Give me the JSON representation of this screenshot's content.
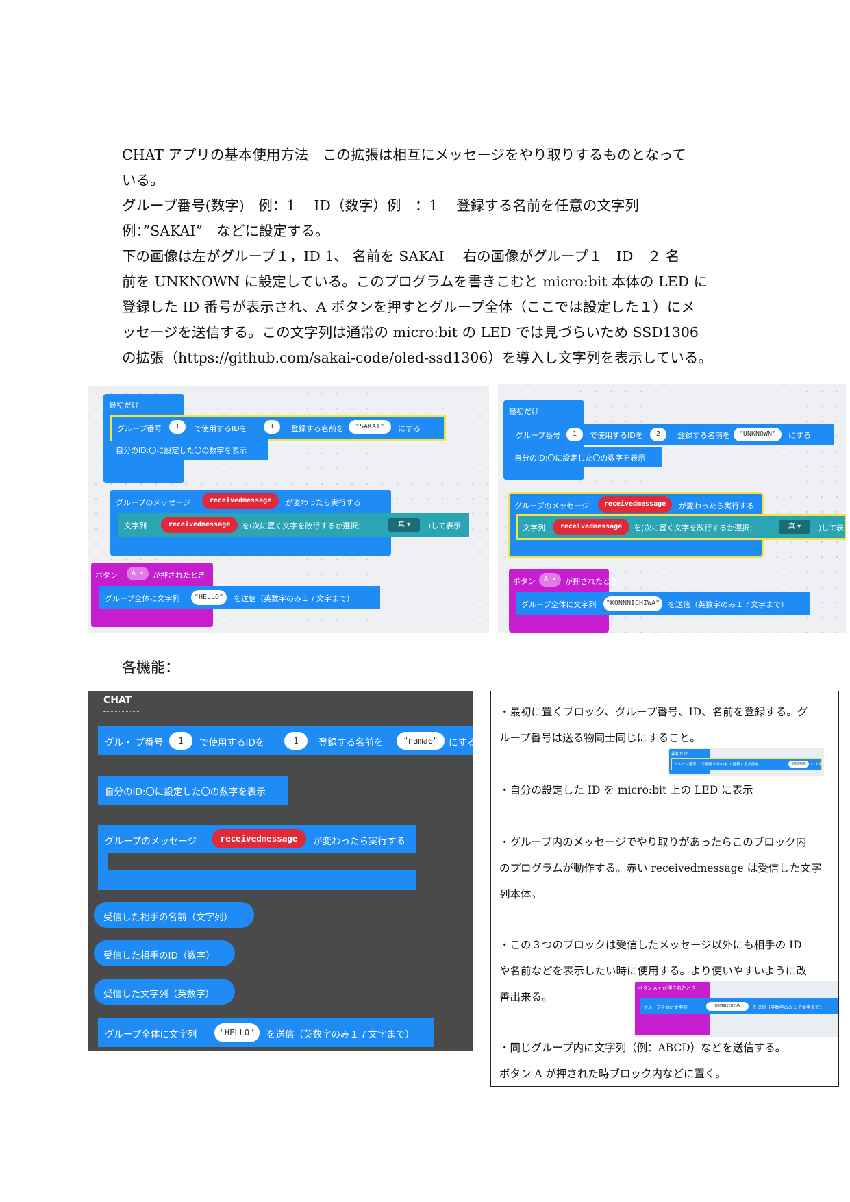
{
  "intro": {
    "line1": "CHAT アプリの基本使用方法　この拡張は相互にメッセージをやり取りするものとなって",
    "line2": "いる。",
    "line3": "グループ番号(数字)　例：1　 ID（数字）例　：1　 登録する名前を任意の文字列",
    "line4": "例：”SAKAI”　などに設定する。",
    "line5": "下の画像は左がグループ１，ID 1、 名前を SAKAI　 右の画像がグループ１　ID　２ 名",
    "line6": "前を UNKNOWN に設定している。このプログラムを書きこむと micro:bit 本体の LED に",
    "line7": "登録した ID 番号が表示され、A ボタンを押すとグループ全体（ここでは設定した１）にメ",
    "line8": "ッセージを送信する。この文字列は通常の micro:bit の LED では見づらいため SSD1306",
    "line9": "の拡張（https://github.com/sakai-code/oled-ssd1306）を導入し文字列を表示している。"
  },
  "left_ws": {
    "start_label": "最初だけ",
    "group_prefix": "グループ番号",
    "group_value": "1",
    "use_id": "で使用するIDを",
    "id_value": "1",
    "reg_name": "登録する名前を",
    "name_value": "\"SAKAI\"",
    "suru": "にする",
    "show_id": "自分のID:〇に設定した〇の数字を表示",
    "group_msg": "グループのメッセージ",
    "received": "receivedmessage",
    "kawattara": "が変わったら実行する",
    "mojiretsu": "文字列",
    "received2": "receivedmessage",
    "kaigyo": "を(次に置く文字を改行するか選択：",
    "true_label": "真 ▾",
    "hyouji": ")して表示",
    "button": "ボタン",
    "button_value": "A ▾",
    "pressed": "が押されたとき",
    "send_prefix": "グループ全体に文字列",
    "send_value": "\"HELLO\"",
    "send_suffix": "を送信（英数字のみ１７文字まで）"
  },
  "right_ws": {
    "start_label": "最初だけ",
    "group_prefix": "グループ番号",
    "group_value": "1",
    "use_id": "で使用するIDを",
    "id_value": "2",
    "reg_name": "登録する名前を",
    "name_value": "\"UNKNOWN\"",
    "suru": "にする",
    "show_id": "自分のID:〇に設定した〇の数字を表示",
    "group_msg": "グループのメッセージ",
    "received": "receivedmessage",
    "kawattara": "が変わったら実行する",
    "mojiretsu": "文字列",
    "received2": "receivedmessage",
    "kaigyo": "を(次に置く文字を改行するか選択：",
    "true_label": "真 ▾",
    "hyouji": ")して表",
    "button": "ボタン",
    "button_value": "A ▾",
    "pressed": "が押されたとき",
    "send_prefix": "グループ全体に文字列",
    "send_value": "\"KONNNICHIWA\"",
    "send_suffix": "を送信（英数字のみ１７文字まで）"
  },
  "heading2": "各機能：",
  "palette": {
    "title": "CHAT",
    "b1_prefix": "グル・ プ番号",
    "b1_group": "1",
    "b1_use_id": "で使用するIDを",
    "b1_id": "1",
    "b1_reg": "登録する名前を",
    "b1_name": "\"namae\"",
    "b1_suru": "にする",
    "b2": "自分のID:〇に設定した〇の数字を表示",
    "b3_prefix": "グループのメッセージ",
    "b3_var": "receivedmessage",
    "b3_suffix": "が変わったら実行する",
    "b4": "受信した相手の名前（文字列）",
    "b5": "受信した相手のID（数字）",
    "b6": "受信した文字列（英数字）",
    "b7_prefix": "グループ全体に文字列",
    "b7_value": "\"HELLO\"",
    "b7_suffix": "を送信（英数字のみ１７文字まで）"
  },
  "desc": {
    "l1": "・最初に置くブロック、グループ番号、ID、名前を登録する。グ",
    "l2": "ループ番号は送る物同士同じにすること。",
    "l3": "・自分の設定した ID を micro:bit 上の LED に表示",
    "l4": "・グループ内のメッセージでやり取りがあったらこのブロック内",
    "l5": "のプログラムが動作する。赤い receivedmessage は受信した文字",
    "l6": "列本体。",
    "l7": "・この３つのブロックは受信したメッセージ以外にも相手の ID",
    "l8": "や名前などを表示したい時に使用する。より使いやすいように改",
    "l9": "善出来る。",
    "l10": "・同じグループ内に文字列（例：ABCD）などを送信する。",
    "l11": "ボタン A が押された時ブロック内などに置く。",
    "mini1_start": "最初だけ",
    "mini1_text": "グループ番号 1 で使用するIDを 2 登録する名前を",
    "mini1_name": "UNKNOWN",
    "mini1_suru": "にする",
    "mini2_head": "ボタン A ▾ が押されたとき",
    "mini2_text": "グループ全体に文字列",
    "mini2_value": "KONNNICHIWA",
    "mini2_suffix": "を送信（英数字のみ１７文字まで）"
  }
}
